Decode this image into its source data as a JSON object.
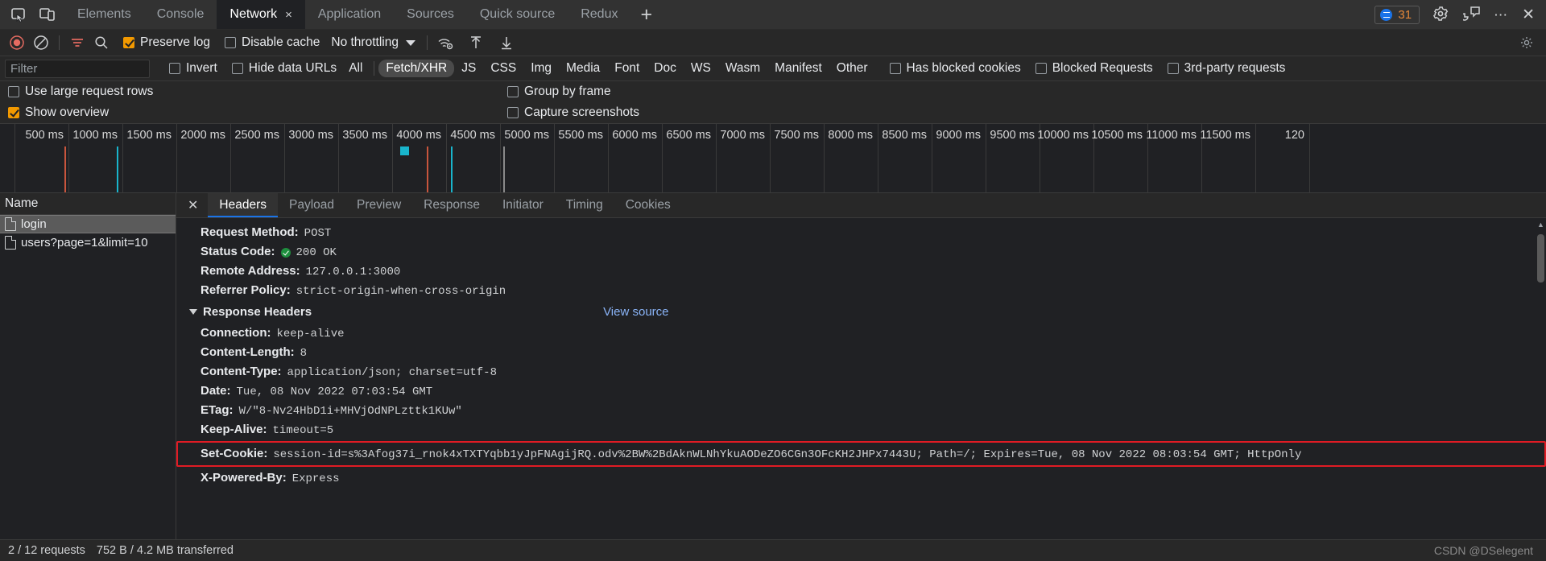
{
  "tabbar": {
    "tabs": [
      {
        "label": "Elements",
        "active": false
      },
      {
        "label": "Console",
        "active": false
      },
      {
        "label": "Network",
        "active": true
      },
      {
        "label": "Application",
        "active": false
      },
      {
        "label": "Sources",
        "active": false
      },
      {
        "label": "Quick source",
        "active": false
      },
      {
        "label": "Redux",
        "active": false
      }
    ],
    "close_label": "×",
    "add_tab_label": "+",
    "issues_count": "31",
    "more_label": "⋯",
    "close_devtools_label": "✕",
    "icons": {
      "inspect": "inspect-element-icon",
      "device": "device-toolbar-icon",
      "settings": "gear-icon",
      "issues": "issues-bubble-icon"
    }
  },
  "toolbar": {
    "record_title": "record-button",
    "clear_title": "clear-button",
    "filter_title": "filter-button",
    "search_title": "search-button",
    "preserve_log": {
      "label": "Preserve log",
      "checked": true
    },
    "disable_cache": {
      "label": "Disable cache",
      "checked": false
    },
    "throttling": "No throttling",
    "network_conditions_title": "network-conditions-icon",
    "import_har_title": "import-har-icon",
    "export_har_title": "export-har-icon",
    "settings_title": "settings-gear-icon"
  },
  "filters": {
    "filter_placeholder": "Filter",
    "invert": {
      "label": "Invert",
      "checked": false
    },
    "hide_data_urls": {
      "label": "Hide data URLs",
      "checked": false
    },
    "types": [
      {
        "label": "All",
        "selected": false
      },
      {
        "label": "Fetch/XHR",
        "selected": true
      },
      {
        "label": "JS",
        "selected": false
      },
      {
        "label": "CSS",
        "selected": false
      },
      {
        "label": "Img",
        "selected": false
      },
      {
        "label": "Media",
        "selected": false
      },
      {
        "label": "Font",
        "selected": false
      },
      {
        "label": "Doc",
        "selected": false
      },
      {
        "label": "WS",
        "selected": false
      },
      {
        "label": "Wasm",
        "selected": false
      },
      {
        "label": "Manifest",
        "selected": false
      },
      {
        "label": "Other",
        "selected": false
      }
    ],
    "has_blocked_cookies": {
      "label": "Has blocked cookies",
      "checked": false
    },
    "blocked_requests": {
      "label": "Blocked Requests",
      "checked": false
    },
    "third_party": {
      "label": "3rd-party requests",
      "checked": false
    }
  },
  "options": {
    "use_large_request_rows": {
      "label": "Use large request rows",
      "checked": false
    },
    "group_by_frame": {
      "label": "Group by frame",
      "checked": false
    },
    "show_overview": {
      "label": "Show overview",
      "checked": true
    },
    "capture_screenshots": {
      "label": "Capture screenshots",
      "checked": false
    }
  },
  "overview": {
    "ticks": [
      "500 ms",
      "1000 ms",
      "1500 ms",
      "2000 ms",
      "2500 ms",
      "3000 ms",
      "3500 ms",
      "4000 ms",
      "4500 ms",
      "5000 ms",
      "5500 ms",
      "6000 ms",
      "6500 ms",
      "7000 ms",
      "7500 ms",
      "8000 ms",
      "8500 ms",
      "9000 ms",
      "9500 ms",
      "10000 ms",
      "10500 ms",
      "11000 ms",
      "11500 ms",
      "120"
    ]
  },
  "requests": {
    "column_header": "Name",
    "rows": [
      {
        "name": "login",
        "selected": true
      },
      {
        "name": "users?page=1&limit=10",
        "selected": false
      }
    ]
  },
  "details": {
    "close_label": "✕",
    "tabs": [
      {
        "label": "Headers",
        "active": true
      },
      {
        "label": "Payload",
        "active": false
      },
      {
        "label": "Preview",
        "active": false
      },
      {
        "label": "Response",
        "active": false
      },
      {
        "label": "Initiator",
        "active": false
      },
      {
        "label": "Timing",
        "active": false
      },
      {
        "label": "Cookies",
        "active": false
      }
    ],
    "general": [
      {
        "key": "Request Method:",
        "value": "POST"
      },
      {
        "key": "Status Code:",
        "value": "200 OK",
        "status_ok": true
      },
      {
        "key": "Remote Address:",
        "value": "127.0.0.1:3000"
      },
      {
        "key": "Referrer Policy:",
        "value": "strict-origin-when-cross-origin"
      }
    ],
    "response_headers_title": "Response Headers",
    "view_source_label": "View source",
    "response_headers": [
      {
        "key": "Connection:",
        "value": "keep-alive"
      },
      {
        "key": "Content-Length:",
        "value": "8"
      },
      {
        "key": "Content-Type:",
        "value": "application/json; charset=utf-8"
      },
      {
        "key": "Date:",
        "value": "Tue, 08 Nov 2022 07:03:54 GMT"
      },
      {
        "key": "ETag:",
        "value": "W/\"8-Nv24HbD1i+MHVjOdNPLzttk1KUw\""
      },
      {
        "key": "Keep-Alive:",
        "value": "timeout=5"
      }
    ],
    "set_cookie": {
      "key": "Set-Cookie:",
      "value": "session-id=s%3Afog37i_rnok4xTXTYqbb1yJpFNAgijRQ.odv%2BW%2BdAknWLNhYkuAODeZO6CGn3OFcKH2JHPx7443U; Path=/; Expires=Tue, 08 Nov 2022 08:03:54 GMT; HttpOnly",
      "highlight_color": "#e01b24"
    },
    "powered_by": {
      "key": "X-Powered-By:",
      "value": "Express"
    }
  },
  "statusbar": {
    "requests": "2 / 12 requests",
    "transferred": "752 B / 4.2 MB transferred",
    "watermark": "CSDN @DSelegent"
  }
}
